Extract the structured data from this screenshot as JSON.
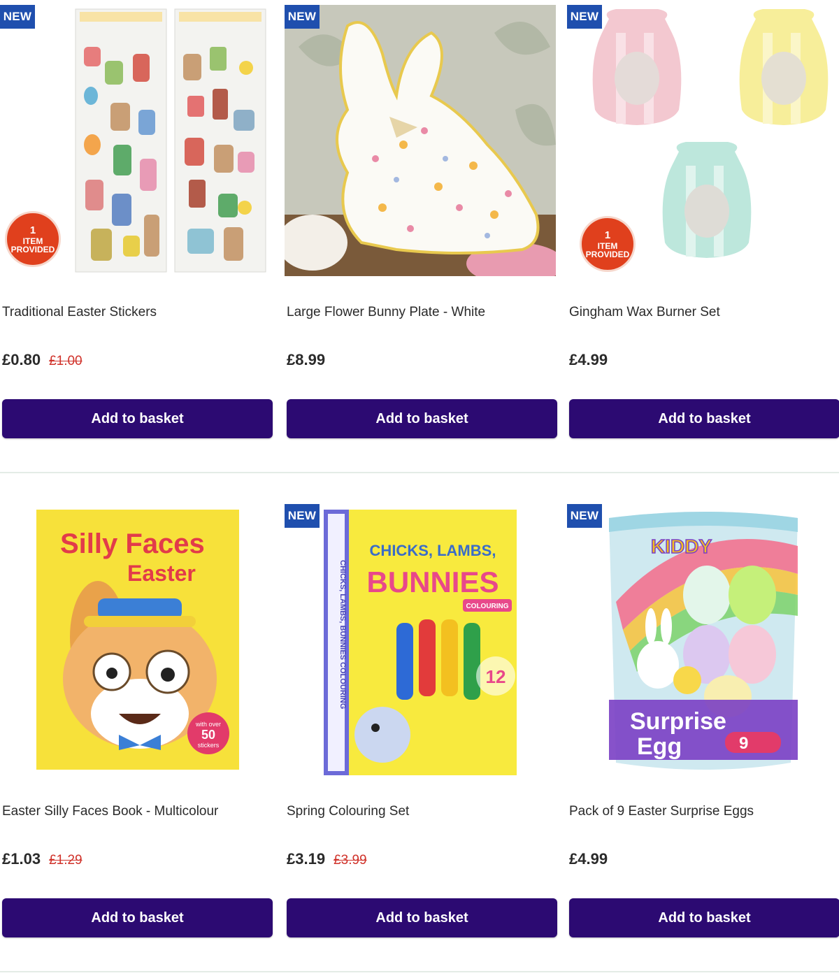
{
  "products": [
    {
      "badge_new": "NEW",
      "badge_item_num": "1",
      "badge_item_text": "ITEM PROVIDED",
      "title": "Traditional Easter Stickers",
      "price": "£0.80",
      "was_price": "£1.00",
      "button": "Add to basket"
    },
    {
      "badge_new": "NEW",
      "title": "Large Flower Bunny Plate - White",
      "price": "£8.99",
      "button": "Add to basket"
    },
    {
      "badge_new": "NEW",
      "badge_item_num": "1",
      "badge_item_text": "ITEM PROVIDED",
      "title": "Gingham Wax Burner Set",
      "price": "£4.99",
      "button": "Add to basket"
    },
    {
      "title": "Easter Silly Faces Book - Multicolour",
      "price": "£1.03",
      "was_price": "£1.29",
      "button": "Add to basket",
      "cover": {
        "line1": "Silly Faces",
        "line2": "Easter",
        "sticker1": "with over",
        "sticker2": "50",
        "sticker3": "stickers"
      }
    },
    {
      "badge_new": "NEW",
      "title": "Spring Colouring Set",
      "price": "£3.19",
      "was_price": "£3.99",
      "button": "Add to basket",
      "cover": {
        "line1": "CHICKS, LAMBS,",
        "line2": "BUNNIES",
        "line3": "COLOURING",
        "count": "12",
        "spine": "CHICKS, LAMBS, BUNNIES COLOURING"
      }
    },
    {
      "badge_new": "NEW",
      "title": "Pack of 9 Easter Surprise Eggs",
      "price": "£4.99",
      "button": "Add to basket",
      "cover": {
        "brand": "KIDDY",
        "line1": "Surprise",
        "line2": "Egg",
        "count": "9"
      }
    }
  ],
  "colors": {
    "button_bg": "#2c0a72",
    "new_badge": "#1f4fae",
    "item_badge": "#e0401d",
    "was_price": "#d0322a"
  }
}
